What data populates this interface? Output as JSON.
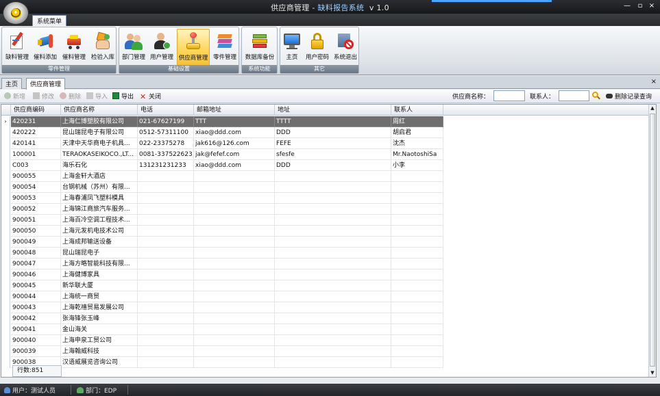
{
  "window": {
    "title_main": "供应商管理 - ",
    "title_app": "缺料报告系统",
    "title_version": "v 1.0",
    "controls": [
      "—",
      "▫",
      "×"
    ]
  },
  "ribbon": {
    "tab": "系统菜单",
    "groups": [
      {
        "title": "零件管理",
        "buttons": [
          {
            "label": "缺料管理",
            "icon": "pencil-note-icon"
          },
          {
            "label": "催料添加",
            "icon": "megaphone-icon"
          },
          {
            "label": "催料管理",
            "icon": "cart-icon"
          },
          {
            "label": "检验入库",
            "icon": "hand-box-icon"
          }
        ]
      },
      {
        "title": "基础设置",
        "buttons": [
          {
            "label": "部门管理",
            "icon": "users-group-icon"
          },
          {
            "label": "用户管理",
            "icon": "user-check-icon"
          },
          {
            "label": "供应商管理",
            "icon": "joystick-icon",
            "active": true
          },
          {
            "label": "零件管理",
            "icon": "stacked-parts-icon"
          }
        ]
      },
      {
        "title": "系统功能",
        "buttons": [
          {
            "label": "数据库备份",
            "icon": "database-books-icon"
          }
        ]
      },
      {
        "title": "其它",
        "buttons": [
          {
            "label": "主页",
            "icon": "monitor-icon"
          },
          {
            "label": "用户密码",
            "icon": "lock-icon"
          },
          {
            "label": "系统退出",
            "icon": "exit-sign-icon"
          }
        ]
      }
    ]
  },
  "doc_tabs": {
    "items": [
      {
        "label": "主页",
        "selected": false
      },
      {
        "label": "供应商管理",
        "selected": true
      }
    ],
    "close": "×"
  },
  "toolbar": {
    "add": "新增",
    "edit": "修改",
    "delete": "删除",
    "import": "导入",
    "export": "导出",
    "close": "关闭",
    "supplier_name_label": "供应商名称：",
    "contact_label": "联系人：",
    "search_icon": "magnifier-icon",
    "deleted_query": "删除记录查询"
  },
  "grid": {
    "columns": [
      "供应商编码",
      "供应商名称",
      "电话",
      "邮箱地址",
      "地址",
      "联系人"
    ],
    "rows": [
      [
        "420231",
        "上海仁博塑胶有限公司",
        "021-67627199",
        "TTT",
        "TTTT",
        "周红"
      ],
      [
        "420222",
        "昆山瑞昆电子有限公司",
        "0512-57311100",
        "xiao@ddd.com",
        "DDD",
        "胡启君"
      ],
      [
        "420141",
        "天津中天华商电子机具...",
        "022-23375278",
        "jak616@126.com",
        "FEFE",
        "沈杰"
      ],
      [
        "100001",
        "TERAOKASEIKOCO.,LT...",
        "0081-337522623",
        "jak@fefef.com",
        "sfesfe",
        "Mr.NaotoshiSa"
      ],
      [
        "C003",
        "海乐石化",
        "131231231233",
        "xiao@ddd.com",
        "DDD",
        "小李"
      ],
      [
        "900055",
        "上海金轩大酒店",
        "",
        "",
        "",
        ""
      ],
      [
        "900054",
        "台钢机械（苏州）有限...",
        "",
        "",
        "",
        ""
      ],
      [
        "900053",
        "上海春浦凤飞塑料模具",
        "",
        "",
        "",
        ""
      ],
      [
        "900052",
        "上海锦江商旅汽车服务...",
        "",
        "",
        "",
        ""
      ],
      [
        "900051",
        "上海百冷空调工程技术...",
        "",
        "",
        "",
        ""
      ],
      [
        "900050",
        "上海元发机电技术公司",
        "",
        "",
        "",
        ""
      ],
      [
        "900049",
        "上海成邦输送设备",
        "",
        "",
        "",
        ""
      ],
      [
        "900048",
        "昆山瑞昆电子",
        "",
        "",
        "",
        ""
      ],
      [
        "900047",
        "上海方略智能科技有限...",
        "",
        "",
        "",
        ""
      ],
      [
        "900046",
        "上海健博家具",
        "",
        "",
        "",
        ""
      ],
      [
        "900045",
        "新华联大厦",
        "",
        "",
        "",
        ""
      ],
      [
        "900044",
        "上海统一商贸",
        "",
        "",
        "",
        ""
      ],
      [
        "900043",
        "上海乾禧贸易发展公司",
        "",
        "",
        "",
        ""
      ],
      [
        "900042",
        "张海锋张玉峰",
        "",
        "",
        "",
        ""
      ],
      [
        "900041",
        "金山海关",
        "",
        "",
        "",
        ""
      ],
      [
        "900040",
        "上海申泉工贸公司",
        "",
        "",
        "",
        ""
      ],
      [
        "900039",
        "上海翰威科技",
        "",
        "",
        "",
        ""
      ],
      [
        "900038",
        "汉语威展览咨询公司",
        "",
        "",
        "",
        ""
      ]
    ],
    "selected_row": 0,
    "row_indicator": "›",
    "footer": "行数:851"
  },
  "status": {
    "user": "用户：测试人员",
    "dept": "部门：EDP"
  }
}
